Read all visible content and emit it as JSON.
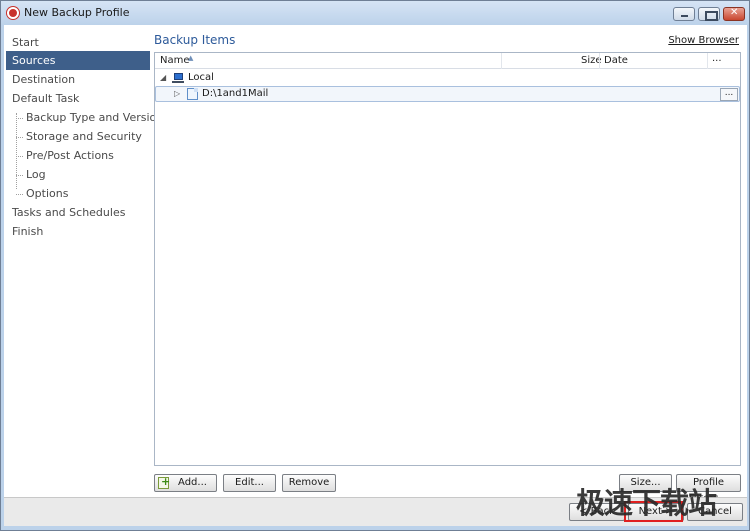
{
  "window": {
    "title": "New Backup Profile"
  },
  "sidebar": {
    "items": [
      {
        "label": "Start"
      },
      {
        "label": "Sources"
      },
      {
        "label": "Destination"
      },
      {
        "label": "Default Task"
      },
      {
        "label": "Backup Type and Versions"
      },
      {
        "label": "Storage and Security"
      },
      {
        "label": "Pre/Post Actions"
      },
      {
        "label": "Log"
      },
      {
        "label": "Options"
      },
      {
        "label": "Tasks and Schedules"
      },
      {
        "label": "Finish"
      }
    ],
    "selected": "Sources"
  },
  "main": {
    "title": "Backup Items",
    "show_browser": "Show Browser",
    "columns": {
      "name": "Name",
      "size": "Size",
      "date": "Date",
      "more": "..."
    },
    "tree": {
      "root": "Local",
      "child": "D:\\1and1Mail",
      "child_button": "..."
    }
  },
  "buttons": {
    "add": "Add...",
    "edit": "Edit...",
    "remove": "Remove",
    "size": "Size...",
    "profile_filters": "Profile Filters...",
    "back": "< Back",
    "next": "Next >",
    "cancel": "Cancel"
  },
  "watermark": "极速下载站",
  "colors": {
    "selection": "#3e5f8a",
    "title": "#2d5a9a",
    "highlight": "#e02020"
  }
}
